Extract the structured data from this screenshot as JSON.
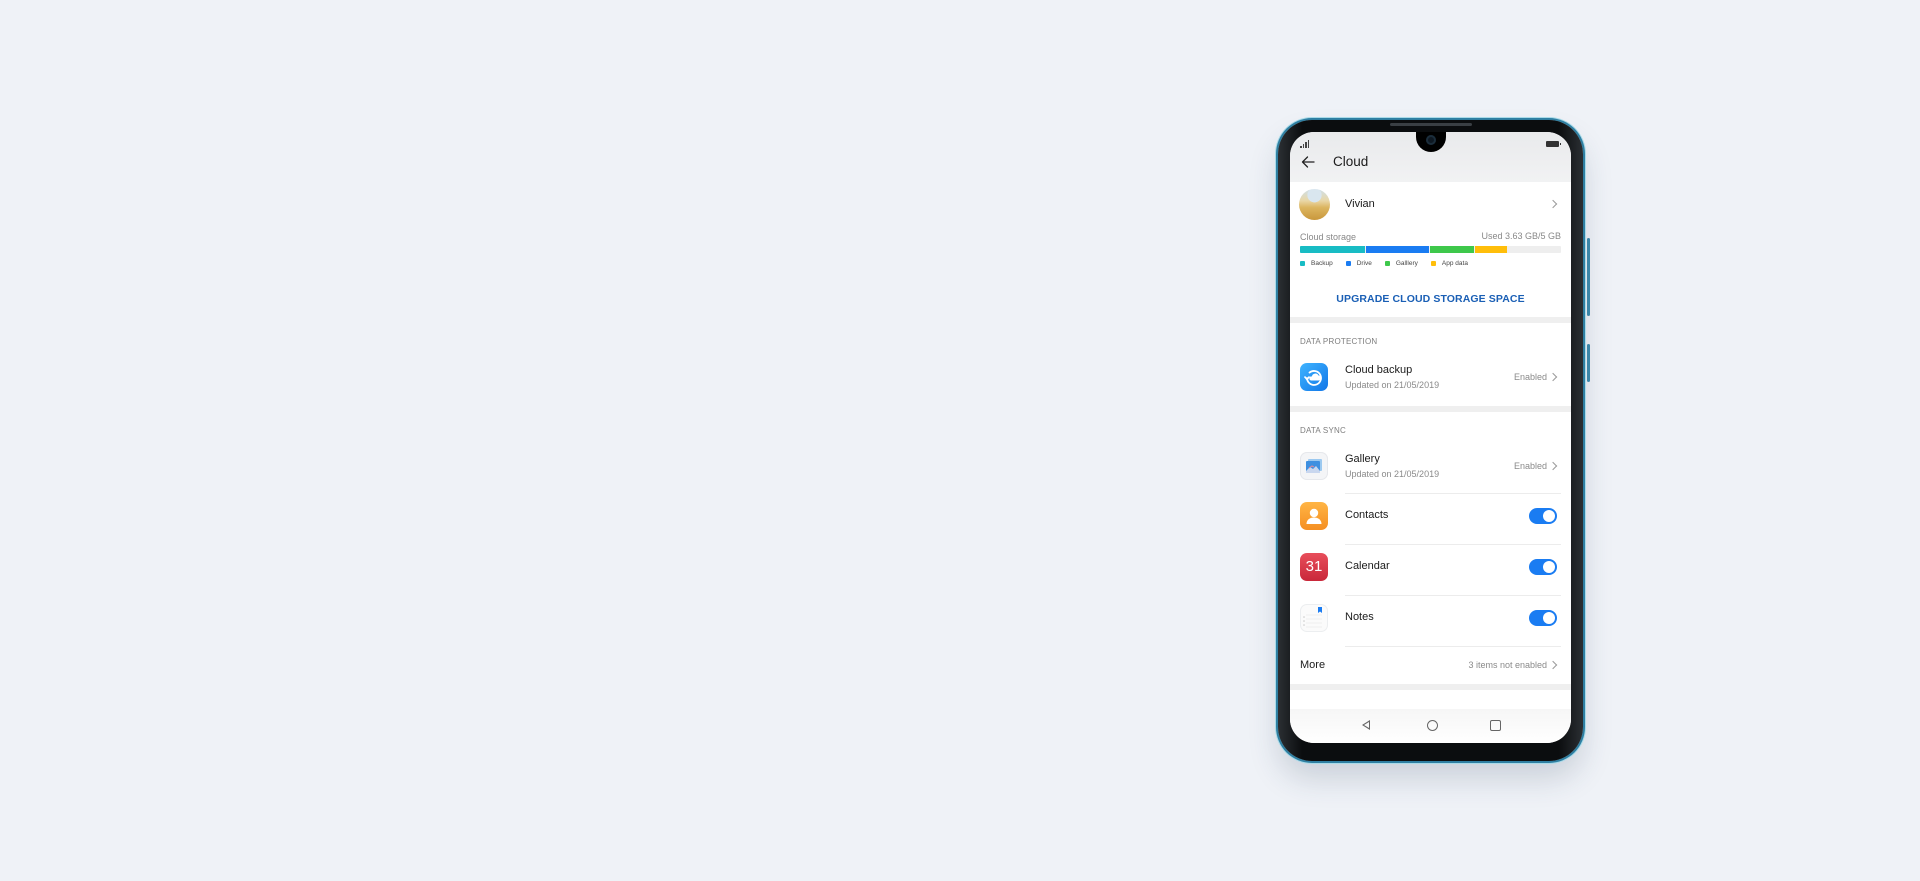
{
  "status_bar": {
    "signal_icon": "signal-icon",
    "battery_icon": "battery-icon"
  },
  "header": {
    "back_icon": "arrow-left-icon",
    "title": "Cloud"
  },
  "profile": {
    "name": "Vivian",
    "avatar": "wheat-field-avatar"
  },
  "storage": {
    "label": "Cloud storage",
    "used_text": "Used 3.63 GB/5 GB",
    "used_gb": 3.63,
    "total_gb": 5,
    "segments": [
      {
        "label": "Backup",
        "color": "#18bcc4",
        "fraction": 0.25
      },
      {
        "label": "Drive",
        "color": "#1a7cf2",
        "fraction": 0.24
      },
      {
        "label": "Galllery",
        "color": "#3ec84b",
        "fraction": 0.17
      },
      {
        "label": "App data",
        "color": "#ffbe0a",
        "fraction": 0.12
      }
    ],
    "upgrade_label": "UPGRADE CLOUD STORAGE SPACE"
  },
  "data_protection": {
    "title": "DATA PROTECTION",
    "items": [
      {
        "name": "Cloud backup",
        "sub": "Updated on 21/05/2019",
        "status": "Enabled",
        "icon": "cloud-backup-icon"
      }
    ]
  },
  "data_sync": {
    "title": "DATA SYNC",
    "gallery": {
      "name": "Gallery",
      "sub": "Updated on 21/05/2019",
      "status": "Enabled",
      "icon": "gallery-icon"
    },
    "toggles": [
      {
        "name": "Contacts",
        "enabled": true,
        "icon": "contacts-icon"
      },
      {
        "name": "Calendar",
        "enabled": true,
        "icon": "calendar-icon",
        "icon_text": "31"
      },
      {
        "name": "Notes",
        "enabled": true,
        "icon": "notes-icon"
      }
    ],
    "more": {
      "label": "More",
      "status": "3 items not enabled"
    }
  },
  "nav_bar": {
    "back": "nav-back-icon",
    "home": "nav-home-icon",
    "recent": "nav-recent-icon"
  }
}
